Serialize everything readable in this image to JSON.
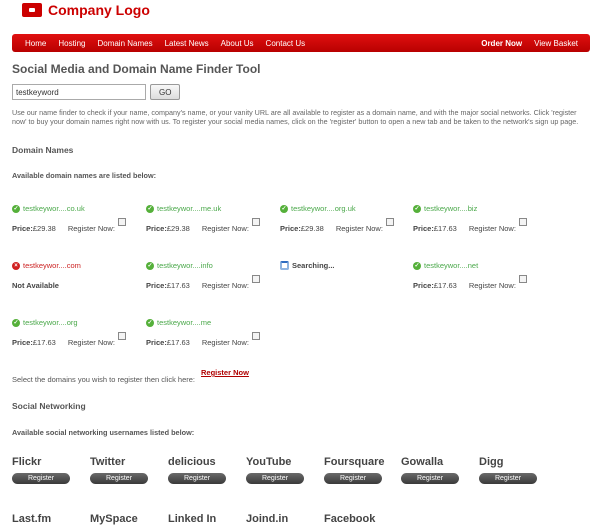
{
  "header": {
    "logo_text": "Company Logo"
  },
  "nav": {
    "left": [
      "Home",
      "Hosting",
      "Domain Names",
      "Latest News",
      "About Us",
      "Contact Us"
    ],
    "right": [
      "Order Now",
      "View Basket"
    ]
  },
  "page": {
    "title": "Social Media and Domain Name Finder Tool",
    "search_value": "testkeyword",
    "go_label": "GO",
    "description": "Use our name finder to check if your name, company's name, or your vanity URL are all available to register as a domain name, and with the major social networks. Click 'register now' to buy your domain names right now with us. To register your social media names, click on the 'register' button to open a new tab and be taken to the network's sign up page."
  },
  "domains": {
    "heading": "Domain Names",
    "subheading": "Available domain names are listed below:",
    "price_label": "Price:",
    "register_label": "Register Now:",
    "items": [
      {
        "name": "testkeywor....co.uk",
        "status": "available",
        "price": "£29.38"
      },
      {
        "name": "testkeywor....me.uk",
        "status": "available",
        "price": "£29.38"
      },
      {
        "name": "testkeywor....org.uk",
        "status": "available",
        "price": "£29.38"
      },
      {
        "name": "testkeywor....biz",
        "status": "available",
        "price": "£17.63"
      },
      {
        "name": "testkeywor....com",
        "status": "unavailable",
        "note": "Not Available"
      },
      {
        "name": "testkeywor....info",
        "status": "available",
        "price": "£17.63"
      },
      {
        "name": "Searching...",
        "status": "searching"
      },
      {
        "name": "testkeywor....net",
        "status": "available",
        "price": "£17.63"
      },
      {
        "name": "testkeywor....org",
        "status": "available",
        "price": "£17.63"
      },
      {
        "name": "testkeywor....me",
        "status": "available",
        "price": "£17.63"
      }
    ],
    "select_text": "Select the domains you wish to register then click here:",
    "register_link": "Register Now"
  },
  "social": {
    "heading": "Social Networking",
    "subheading": "Available social networking usernames listed below:",
    "button_label": "Register",
    "networks": [
      "Flickr",
      "Twitter",
      "delicious",
      "YouTube",
      "Foursquare",
      "Gowalla",
      "Digg",
      "Last.fm",
      "MySpace",
      "Linked In",
      "Joind.in",
      "Facebook"
    ]
  },
  "colors": {
    "brand_red": "#cc0000",
    "available_green": "#4aa84a"
  }
}
